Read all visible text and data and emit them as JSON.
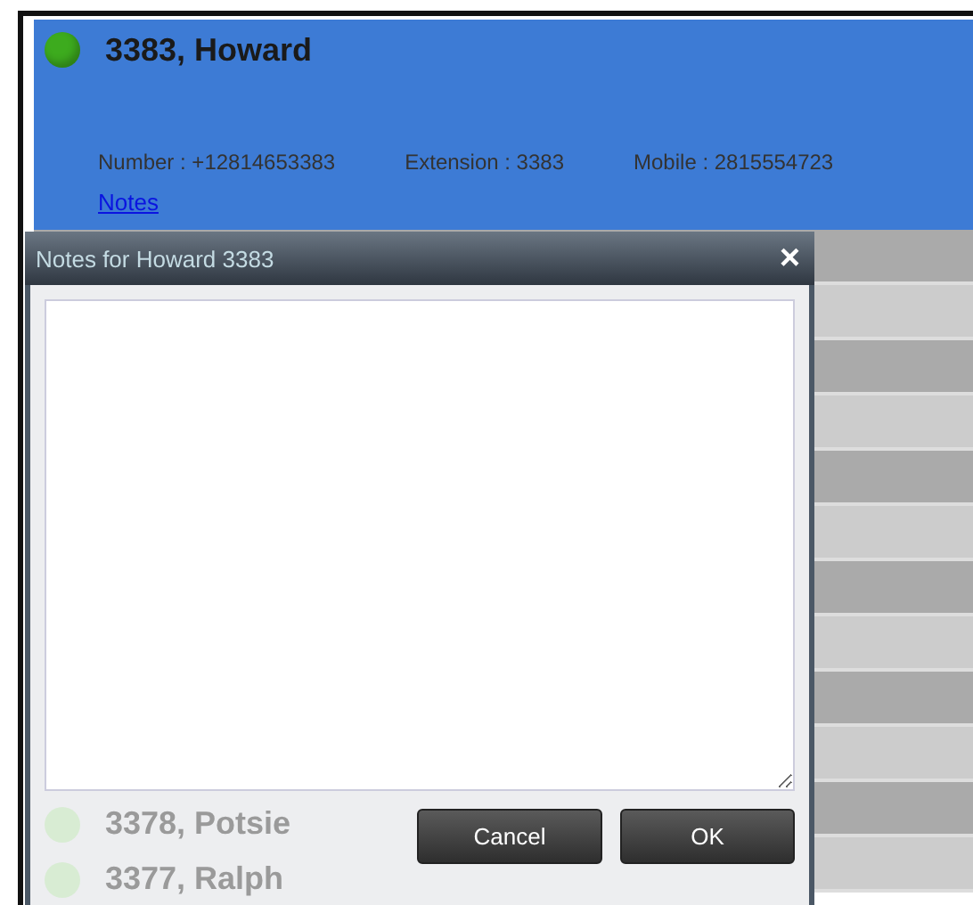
{
  "contact": {
    "name": "3383, Howard",
    "color": "#3dab1e",
    "fields": [
      {
        "label": "Number : +12814653383"
      },
      {
        "label": "Extension : 3383"
      },
      {
        "label": "Mobile : 2815554723"
      }
    ],
    "notes_link": "Notes"
  },
  "list": [
    {
      "name": "3378, Potsie",
      "color": "#d8ecd3"
    },
    {
      "name": "3377, Ralph",
      "color": "#d8ecd3"
    }
  ],
  "dialog": {
    "title": "Notes for Howard 3383",
    "close": "×",
    "buttons": [
      "Cancel",
      "OK"
    ]
  }
}
